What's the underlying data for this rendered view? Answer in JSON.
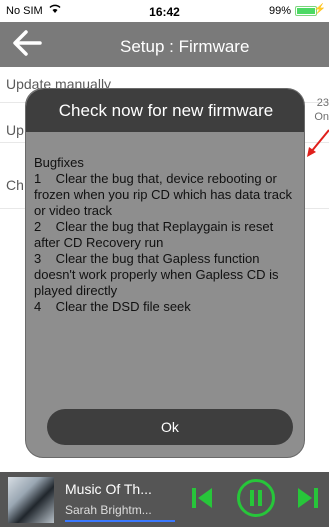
{
  "status_bar": {
    "carrier": "No SIM",
    "time": "16:42",
    "battery": "99%"
  },
  "header": {
    "title": "Setup : Firmware"
  },
  "settings": {
    "rows": [
      {
        "label": "Update manually",
        "value": "23"
      },
      {
        "label": "Up",
        "value": "On"
      },
      {
        "label": "Ch",
        "value": ""
      }
    ]
  },
  "dialog": {
    "title": "Check now for new firmware",
    "body": "Bugfixes\n1    Clear the bug that, device rebooting or frozen when you rip CD which has data track or video track\n2    Clear the bug that Replaygain is reset after CD Recovery run\n3    Clear the bug that Gapless function doesn't work properly when Gapless CD is played directly\n4    Clear the DSD file seek",
    "ok_label": "Ok"
  },
  "player": {
    "song": "Music Of Th...",
    "artist": "Sarah Brightm..."
  },
  "colors": {
    "header_bg": "#7a7a7a",
    "dialog_bg": "#8e8e8e",
    "dialog_dark": "#3e3e3e",
    "accent_green": "#27c63a",
    "annotation_red": "#e0201c"
  }
}
